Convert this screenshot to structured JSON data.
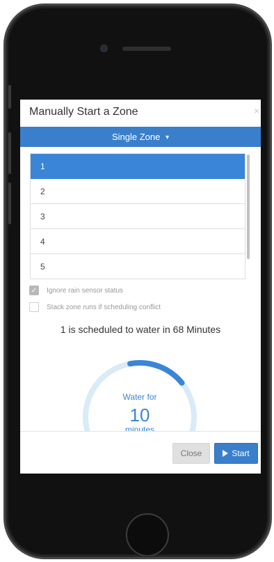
{
  "modal": {
    "title": "Manually Start a Zone",
    "close_glyph": "×"
  },
  "zone_selector": {
    "label": "Single Zone",
    "caret": "▾"
  },
  "zones": {
    "items": [
      {
        "label": "1",
        "selected": true
      },
      {
        "label": "2",
        "selected": false
      },
      {
        "label": "3",
        "selected": false
      },
      {
        "label": "4",
        "selected": false
      },
      {
        "label": "5",
        "selected": false
      }
    ]
  },
  "options": {
    "ignore_rain_sensor": {
      "label": "Ignore rain sensor status",
      "checked": true
    },
    "stack_zone_runs": {
      "label": "Stack zone runs if scheduling conflict",
      "checked": false
    }
  },
  "status": {
    "schedule_text": "1 is scheduled to water in 68 Minutes"
  },
  "dial": {
    "label_top": "Water for",
    "value": "10",
    "unit": "minutes",
    "level_fraction": 0.17
  },
  "footer": {
    "close_label": "Close",
    "start_label": "Start"
  },
  "icons": {
    "start": "play-icon",
    "dropdown": "caret-down-icon",
    "modal_close": "close-icon",
    "checkmark": "check-icon"
  },
  "colors": {
    "accent": "#3a7fcc",
    "selected_row": "#3a85d8",
    "dial_track": "#d9ebf7",
    "dial_fill": "#3a85d8"
  }
}
